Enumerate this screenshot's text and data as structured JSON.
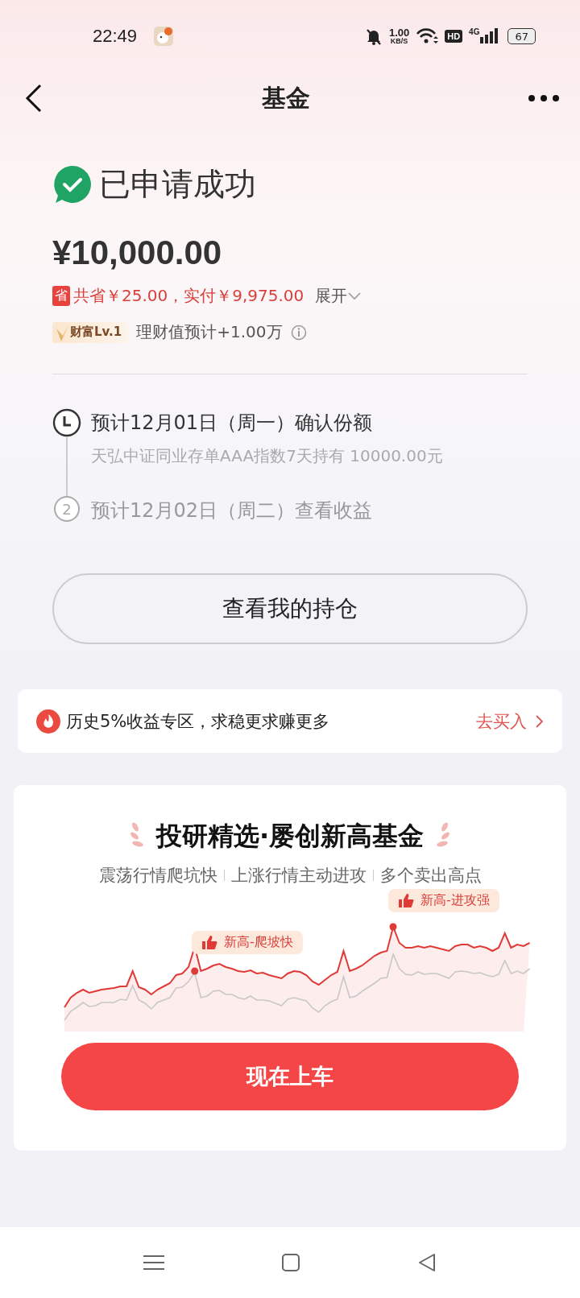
{
  "status_bar": {
    "time": "22:49",
    "net_speed": "1.00",
    "net_unit": "KB/S",
    "hd": "HD",
    "network": "4G",
    "battery": "67"
  },
  "nav": {
    "title": "基金"
  },
  "result": {
    "title": "已申请成功",
    "amount": "¥10,000.00",
    "savings_badge": "省",
    "savings": "共省￥25.00，实付￥9,975.00",
    "expand": "展开",
    "level_badge": "财富Lv.1",
    "level_note": "理财值预计+1.00万"
  },
  "steps": [
    {
      "kind": "clock",
      "active": true,
      "title": "预计12月01日（周一）确认份额",
      "detail": "天弘中证同业存单AAA指数7天持有 10000.00元"
    },
    {
      "kind": "number",
      "active": false,
      "number": "2",
      "title": "预计12月02日（周二）查看收益"
    }
  ],
  "holdings_button": "查看我的持仓",
  "promo": {
    "text": "历史5%收益专区，求稳更求赚更多",
    "link": "去买入"
  },
  "feature": {
    "title": "投研精选·屡创新高基金",
    "tags": [
      "震荡行情爬坑快",
      "上涨行情主动进攻",
      "多个卖出高点"
    ],
    "callouts": [
      "新高-爬坡快",
      "新高-进攻强"
    ],
    "cta": "现在上车"
  }
}
